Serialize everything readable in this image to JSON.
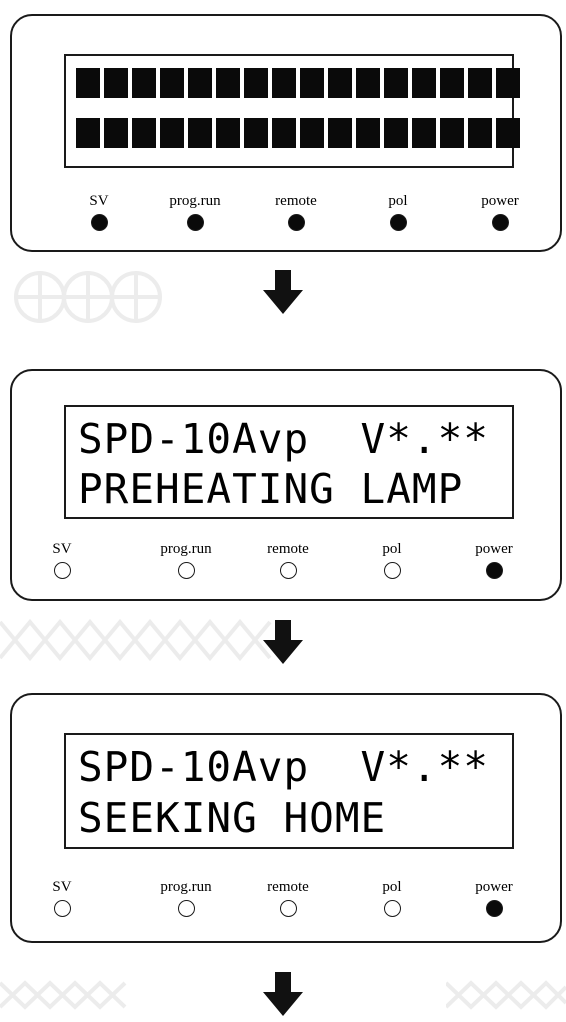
{
  "panels": [
    {
      "lcd_line1": "",
      "lcd_line2": "",
      "blank": true,
      "leds": [
        {
          "label": "SV",
          "on": true
        },
        {
          "label": "prog.run",
          "on": true
        },
        {
          "label": "remote",
          "on": true
        },
        {
          "label": "pol",
          "on": true
        },
        {
          "label": "power",
          "on": true
        }
      ]
    },
    {
      "lcd_line1": "SPD-10Avp  V*.**",
      "lcd_line2": "PREHEATING LAMP",
      "blank": false,
      "leds": [
        {
          "label": "SV",
          "on": false
        },
        {
          "label": "prog.run",
          "on": false
        },
        {
          "label": "remote",
          "on": false
        },
        {
          "label": "pol",
          "on": false
        },
        {
          "label": "power",
          "on": true
        }
      ]
    },
    {
      "lcd_line1": "SPD-10Avp  V*.**",
      "lcd_line2": "SEEKING HOME",
      "blank": false,
      "leds": [
        {
          "label": "SV",
          "on": false
        },
        {
          "label": "prog.run",
          "on": false
        },
        {
          "label": "remote",
          "on": false
        },
        {
          "label": "pol",
          "on": false
        },
        {
          "label": "power",
          "on": true
        }
      ]
    }
  ],
  "arrows": [
    {
      "icon": "down-arrow-icon"
    },
    {
      "icon": "down-arrow-icon"
    },
    {
      "icon": "down-arrow-icon"
    }
  ]
}
